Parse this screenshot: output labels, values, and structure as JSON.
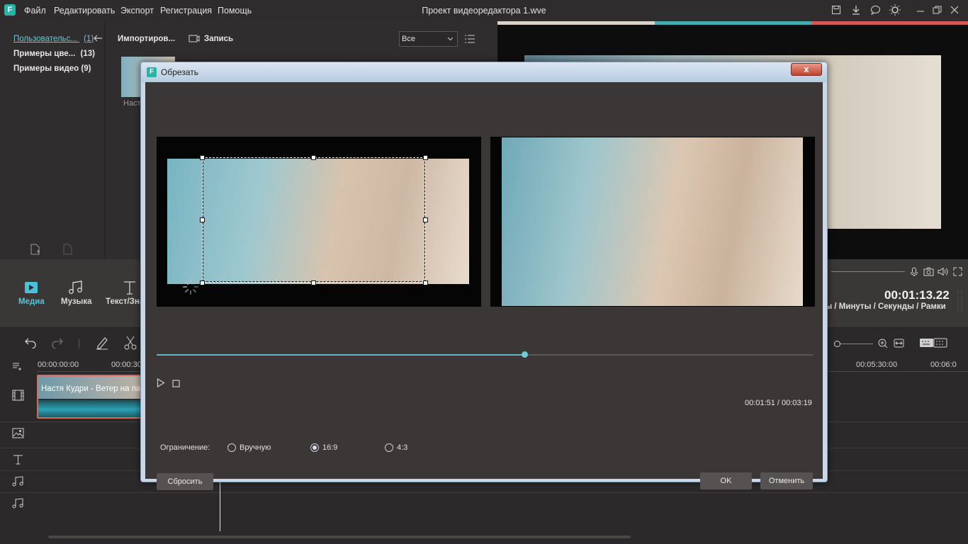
{
  "app": {
    "logo": "F",
    "title": "Проект видеоредактора 1.wve",
    "menu": [
      "Файл",
      "Редактировать",
      "Экспорт",
      "Регистрация",
      "Помощь"
    ]
  },
  "library": {
    "items": [
      {
        "label": "Пользовательс...",
        "count": "(1)"
      },
      {
        "label": "Примеры цве...",
        "count": "(13)"
      },
      {
        "label": "Примеры видео",
        "count": "(9)"
      }
    ]
  },
  "media": {
    "import_label": "Импортиров...",
    "record_label": "Запись",
    "filter_value": "Все",
    "thumb_label": "Наст"
  },
  "tabs": {
    "media": "Медиа",
    "music": "Музыка",
    "text": "Текст/Зна"
  },
  "preview": {
    "timecode": "00:01:13.22",
    "units": "сы / Минуты / Секунды / Рамки"
  },
  "timeline": {
    "ruler": [
      "00:00:00:00",
      "00:00:30",
      "00:05:30:00",
      "00:06:0"
    ],
    "clip_title": "Настя Кудри - Ветер на пал"
  },
  "dialog": {
    "logo": "F",
    "title": "Обрезать",
    "close_label": "x",
    "time_readout": "00:01:51 / 00:03:19",
    "progress_fraction": 0.56,
    "constraint_label": "Ограничение:",
    "options": [
      "Вручную",
      "16:9",
      "4:3"
    ],
    "selected_option": "16:9",
    "reset_label": "Сбросить",
    "ok_label": "OK",
    "cancel_label": "Отменить"
  },
  "colors": {
    "accent": "#5fb8cc",
    "clip_border": "#d86b5e",
    "dialog_bg": "#3b3737"
  }
}
